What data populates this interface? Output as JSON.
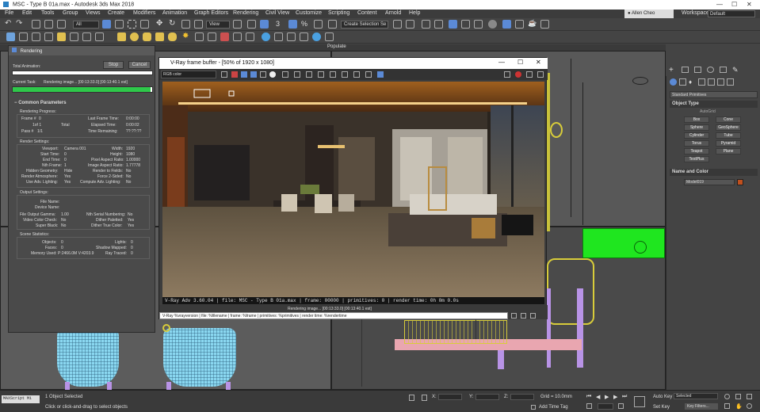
{
  "app": {
    "title": "MSC - Type B 01a.max - Autodesk 3ds Max 2018",
    "user": "Allen Cheo",
    "workspaces_label": "Workspaces:",
    "workspace_value": "Default"
  },
  "menus": [
    "File",
    "Edit",
    "Tools",
    "Group",
    "Views",
    "Create",
    "Modifiers",
    "Animation",
    "Graph Editors",
    "Rendering",
    "Civil View",
    "Customize",
    "Scripting",
    "Content",
    "Arnold",
    "Help"
  ],
  "toolbar": {
    "selection_filter": "All",
    "view_dropdown": "View",
    "named_selection": "Create Selection Se"
  },
  "ribbon": {
    "populate_tab": "Populate"
  },
  "rendering_dialog": {
    "title": "Rendering",
    "total_animation_label": "Total Animation:",
    "stop_button": "Stop",
    "cancel_button": "Cancel",
    "current_task_label": "Current Task:",
    "current_task_value": "Rendering image... [00:13:33.0] [00:13:40.1 est]",
    "progress_percent": 99,
    "common_params_header": "Common Parameters",
    "render_progress_header": "Rendering Progress:",
    "frame_label": "Frame #",
    "frame_value": "0",
    "of_text": "1of 1",
    "total_label": "Total",
    "pass_label": "Pass #",
    "pass_value": "1/1",
    "last_frame_time_label": "Last Frame Time:",
    "last_frame_time_value": "0:00:00",
    "elapsed_time_label": "Elapsed Time:",
    "elapsed_time_value": "0:00:02",
    "time_remaining_label": "Time Remaining:",
    "time_remaining_value": "??:??:??",
    "render_settings_header": "Render Settings:",
    "viewport_label": "Viewport:",
    "viewport_value": "Camera 001",
    "width_label": "Width:",
    "width_value": "1920",
    "start_time_label": "Start Time:",
    "start_time_value": "0",
    "height_label": "Height:",
    "height_value": "1080",
    "end_time_label": "End Time:",
    "end_time_value": "0",
    "pixel_aspect_label": "Pixel Aspect Ratio:",
    "pixel_aspect_value": "1.00000",
    "nth_frame_label": "Nth Frame:",
    "nth_frame_value": "1",
    "image_aspect_label": "Image Aspect Ratio:",
    "image_aspect_value": "1.77778",
    "hidden_geom_label": "Hidden Geometry:",
    "hidden_geom_value": "Hide",
    "render_fields_label": "Render to Fields:",
    "render_fields_value": "No",
    "render_atmos_label": "Render Atmosphere:",
    "render_atmos_value": "Yes",
    "force_2sided_label": "Force 2-Sided:",
    "force_2sided_value": "No",
    "adv_lighting_label": "Use Adv. Lighting:",
    "adv_lighting_value": "Yes",
    "compute_adv_label": "Compute Adv. Lighting:",
    "compute_adv_value": "No",
    "output_settings_header": "Output Settings:",
    "file_name_label": "File Name:",
    "device_name_label": "Device Name:",
    "file_gamma_label": "File Output Gamma:",
    "file_gamma_value": "1.00",
    "nth_serial_label": "Nth Serial Numbering:",
    "nth_serial_value": "No",
    "video_color_label": "Video Color Check:",
    "video_color_value": "No",
    "dither_paletted_label": "Dither Paletted:",
    "dither_paletted_value": "Yes",
    "super_black_label": "Super Black:",
    "super_black_value": "No",
    "dither_true_label": "Dither True Color:",
    "dither_true_value": "Yes",
    "scene_stats_header": "Scene Statistics:",
    "objects_label": "Objects:",
    "objects_value": "0",
    "lights_label": "Lights:",
    "lights_value": "0",
    "faces_label": "Faces:",
    "faces_value": "0",
    "shadow_mapped_label": "Shadow Mapped:",
    "shadow_mapped_value": "0",
    "memory_label": "Memory Used:",
    "memory_value": "P:2466.0M V:4203.9",
    "ray_traced_label": "Ray Traced:",
    "ray_traced_value": "0"
  },
  "vfb": {
    "title": "V-Ray frame buffer - [50% of 1920 x 1080]",
    "channel": "RGB color",
    "stamp": "V-Ray Adv 3.60.04 | file: MSC - Type B 01a.max | frame: 00000 | primitives: 0 | render time: 0h 0m 0.0s",
    "status": "Rendering image... [00:13:33.0] [00:13:40.1 est]",
    "stamp_field": "V-Ray %vrayversion | file: %filename | frame: %frame | primitives: %primitives | render time: %rendertime"
  },
  "command_panel": {
    "dropdown": "Standard Primitives",
    "object_type_header": "Object Type",
    "autogrid": "AutoGrid",
    "buttons": [
      "Box",
      "Cone",
      "Sphere",
      "GeoSphere",
      "Cylinder",
      "Tube",
      "Torus",
      "Pyramid",
      "Teapot",
      "Plane",
      "TextPlus"
    ],
    "name_color_header": "Name and Color",
    "name_value": "Model019"
  },
  "status_bar": {
    "maxscript": "MAXScript Mi",
    "selection_text": "1 Object Selected",
    "prompt_text": "Click or click-and-drag to select objects",
    "x_label": "X:",
    "y_label": "Y:",
    "z_label": "Z:",
    "grid_text": "Grid = 10.0mm",
    "add_time_tag": "Add Time Tag",
    "auto_key": "Auto Key",
    "set_key": "Set Key",
    "selected_dropdown": "Selected",
    "key_filters": "Key Filters..."
  },
  "colors": {
    "accent": "#5b8ad6",
    "progress": "#2ec84a",
    "wire_blue": "#8ad7f0",
    "green_box": "#1fe61f",
    "pink": "#e9a6b0",
    "violet": "#b893e6",
    "name_swatch": "#c0501e"
  }
}
